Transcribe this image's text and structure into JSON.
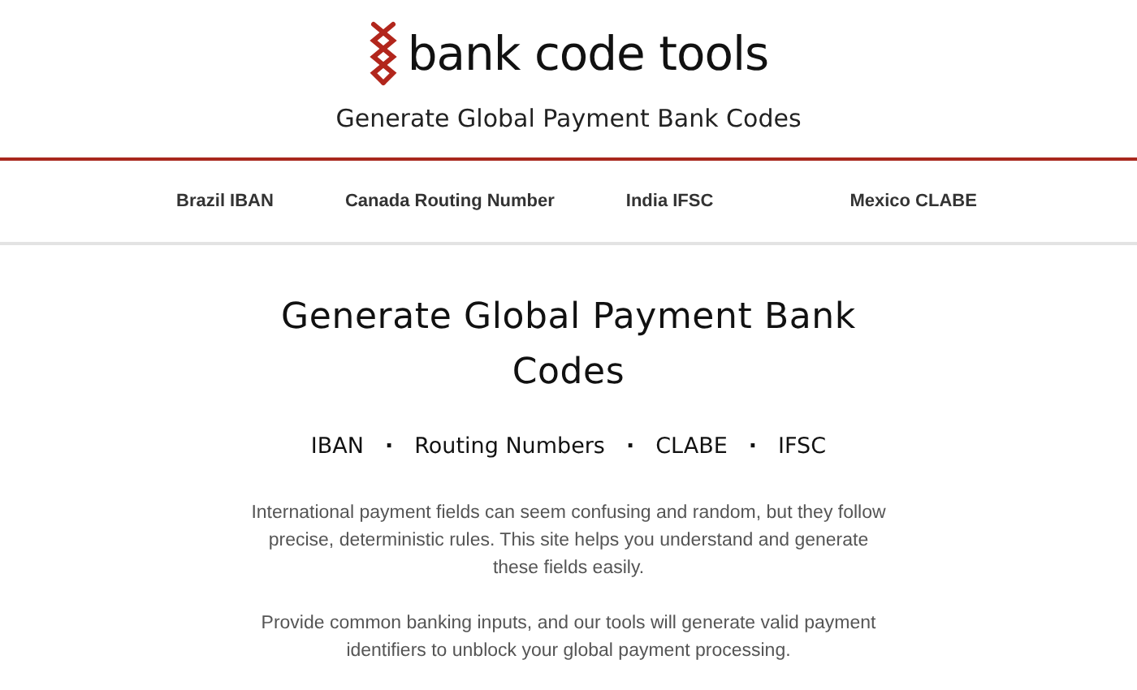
{
  "header": {
    "logo_text": "bank code tools",
    "tagline": "Generate Global Payment Bank Codes"
  },
  "nav": [
    {
      "label": "Brazil IBAN"
    },
    {
      "label": "Canada Routing Number"
    },
    {
      "label": "India IFSC"
    },
    {
      "label": "Mexico CLABE"
    }
  ],
  "hero": {
    "title": "Generate Global Payment Bank Codes",
    "separator": "·",
    "tags": [
      "IBAN",
      "Routing Numbers",
      "CLABE",
      "IFSC"
    ],
    "paragraphs": [
      "International payment fields can seem confusing and random, but they follow precise, deterministic rules. This site helps you understand and generate these fields easily.",
      "Provide common banking inputs, and our tools will generate valid payment identifiers to unblock your global payment processing."
    ]
  }
}
